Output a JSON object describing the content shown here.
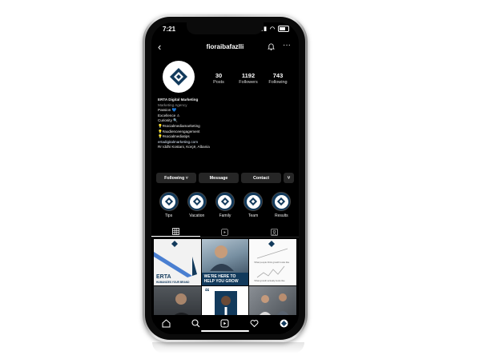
{
  "status": {
    "time": "7:21",
    "signal": "▮▮▮ ◠"
  },
  "profile": {
    "username": "fioraibafazlli",
    "stats": [
      {
        "value": "30",
        "label": "Posts"
      },
      {
        "value": "1192",
        "label": "Followers"
      },
      {
        "value": "743",
        "label": "Following"
      }
    ],
    "bio": {
      "name": "ERTA Digital Marketing",
      "category": "Marketing Agency",
      "lines": [
        "Passion 💙",
        "Excellence ⚠",
        "Curiosity 🔍",
        "💡#socialmediamarketing",
        "💡#audienceengagement",
        "💡#socialmediatips"
      ],
      "link": "ertadigitalmarketing.com",
      "address": "Rr Iddhi Kostani, Korçë, Albania"
    }
  },
  "actions": {
    "following": "Following ˅",
    "message": "Message",
    "contact": "Contact",
    "more": "˅"
  },
  "highlights": [
    "Tips",
    "Vacation",
    "Family",
    "Team",
    "Results"
  ],
  "posts": {
    "p1_brand": "ERTA",
    "p1_tag": "HUMANIZES YOUR BRAND",
    "p2_text": "WE'RE HERE TO HELP YOU GROW",
    "p3_line1": "What people think growth looks like",
    "p3_line2": "What growth actually looks like",
    "p5_quote": "“"
  },
  "colors": {
    "accent": "#123a5c",
    "brand_blue": "#4a7fd1"
  },
  "icons": [
    "back-arrow-icon",
    "add-post-icon",
    "more-dots-icon",
    "grid-icon",
    "reels-icon",
    "tagged-icon",
    "home-icon",
    "search-icon",
    "reels-nav-icon",
    "heart-icon",
    "profile-avatar-icon"
  ]
}
